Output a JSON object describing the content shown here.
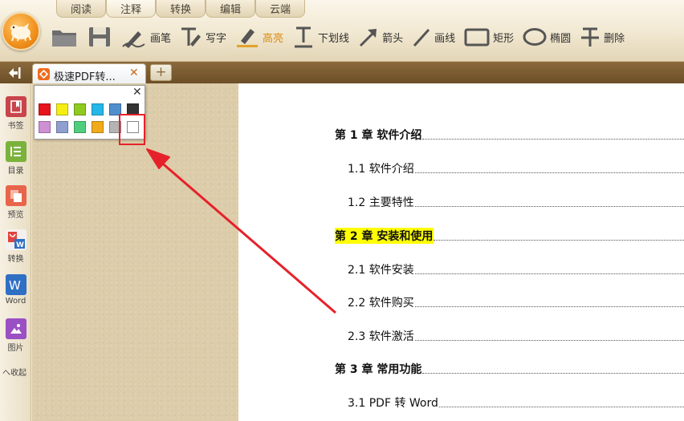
{
  "menu_tabs": [
    {
      "label": "阅读"
    },
    {
      "label": "注释"
    },
    {
      "label": "转换"
    },
    {
      "label": "编辑"
    },
    {
      "label": "云端"
    }
  ],
  "toolbar": {
    "draw_label": "画笔",
    "write_label": "写字",
    "highlight_label": "高亮",
    "underline_label": "下划线",
    "arrow_label": "箭头",
    "line_label": "画线",
    "rect_label": "矩形",
    "ellipse_label": "椭圆",
    "strike_label": "删除"
  },
  "document_tab": {
    "title": "极速PDF转...",
    "close_symbol": "✕",
    "add_symbol": "+"
  },
  "sidebar": {
    "items": [
      {
        "label": "书签",
        "color": "#c8454b"
      },
      {
        "label": "目录",
        "color": "#7bb23b"
      },
      {
        "label": "预览",
        "color": "#e8644a"
      },
      {
        "label": "转换",
        "color": "#e0433c"
      },
      {
        "label": "Word",
        "color": "#2f6fc4"
      },
      {
        "label": "图片",
        "color": "#9b4fc4"
      }
    ],
    "collapse_label": "へ收起"
  },
  "color_popup": {
    "close_symbol": "✕",
    "swatches": [
      "#e8141b",
      "#f6ee12",
      "#8fca1f",
      "#25b7e8",
      "#4f8fcc",
      "#333333",
      "#cf8fd4",
      "#8f9fd0",
      "#4fcf7e",
      "#f1ab1a",
      "#b4b4b4",
      "#ffffff"
    ],
    "selected_color": "#ffffff"
  },
  "toc": {
    "entries": [
      {
        "text": "第 1 章  软件介绍",
        "chapter": true,
        "highlighted": false
      },
      {
        "text": "1.1 软件介绍",
        "chapter": false,
        "highlighted": false
      },
      {
        "text": "1.2 主要特性",
        "chapter": false,
        "highlighted": false
      },
      {
        "text": "第 2 章   安装和使用",
        "chapter": true,
        "highlighted": true
      },
      {
        "text": "2.1 软件安装",
        "chapter": false,
        "highlighted": false
      },
      {
        "text": "2.2 软件购买",
        "chapter": false,
        "highlighted": false
      },
      {
        "text": "2.3 软件激活",
        "chapter": false,
        "highlighted": false
      },
      {
        "text": "第 3 章  常用功能",
        "chapter": true,
        "highlighted": false
      },
      {
        "text": "3.1  PDF 转 Word",
        "chapter": false,
        "highlighted": false
      }
    ]
  },
  "colors": {
    "accent_orange": "#d98a12",
    "annotation_red": "#e5222a",
    "highlight_yellow": "#ffff00"
  }
}
